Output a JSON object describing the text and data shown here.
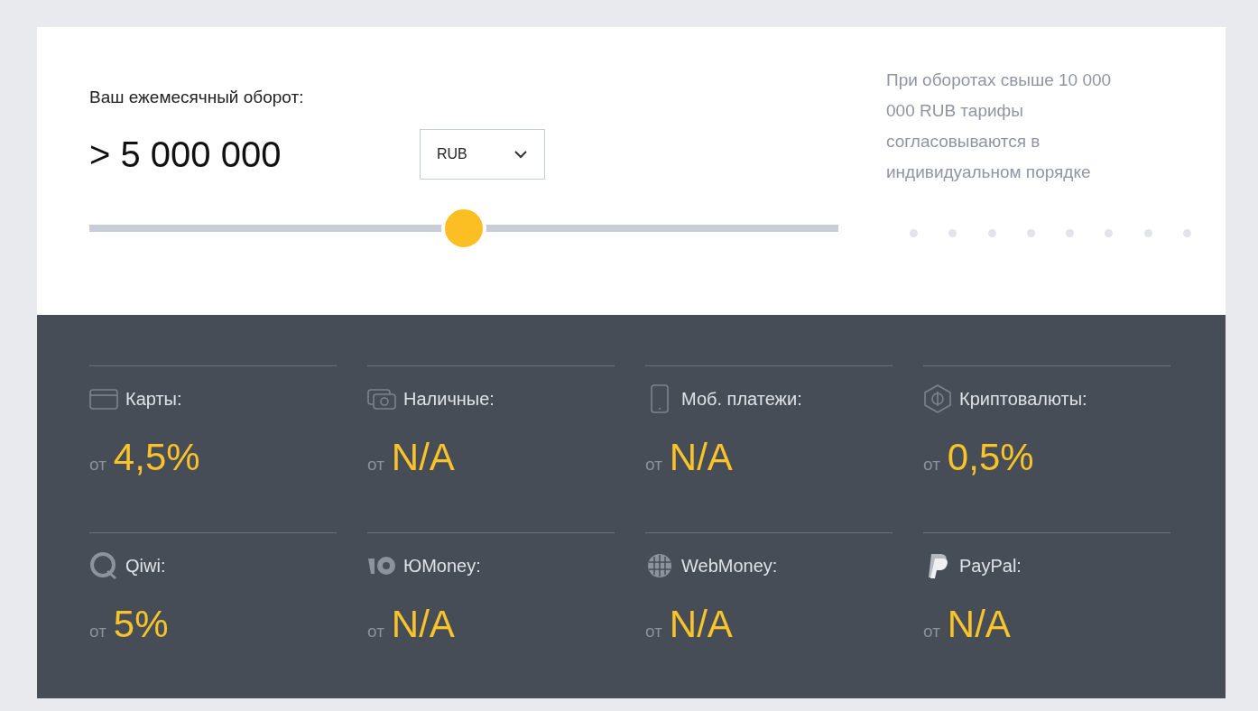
{
  "turnover": {
    "label": "Ваш ежемесячный оборот:",
    "value": "> 5 000 000",
    "currency": "RUB",
    "level": 0.5
  },
  "note": "При оборотах свыше 10 000 000 RUB тарифы согласовываются в индивидуальном порядке",
  "methods": [
    {
      "kind": "card",
      "name": "Карты:",
      "prefix": "от",
      "rate": "4,5%"
    },
    {
      "kind": "cash",
      "name": "Наличные:",
      "prefix": "от",
      "rate": "N/A"
    },
    {
      "kind": "phone",
      "name": "Моб. платежи:",
      "prefix": "от",
      "rate": "N/A"
    },
    {
      "kind": "crypto",
      "name": "Криптовалюты:",
      "prefix": "от",
      "rate": "0,5%"
    },
    {
      "kind": "qiwi",
      "name": "Qiwi:",
      "prefix": "от",
      "rate": "5%"
    },
    {
      "kind": "yoomoney",
      "name": "ЮMoney:",
      "prefix": "от",
      "rate": "N/A"
    },
    {
      "kind": "webmoney",
      "name": "WebMoney:",
      "prefix": "от",
      "rate": "N/A"
    },
    {
      "kind": "paypal",
      "name": "PayPal:",
      "prefix": "от",
      "rate": "N/A"
    }
  ]
}
